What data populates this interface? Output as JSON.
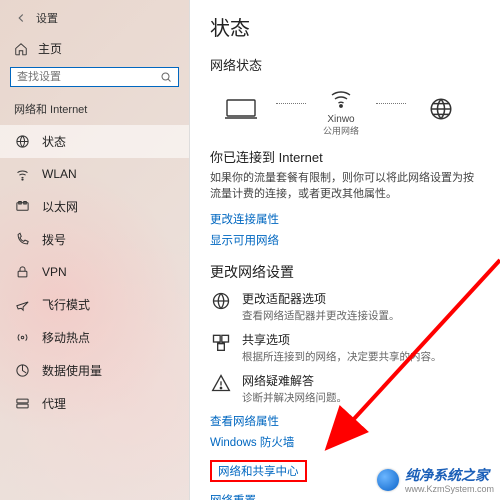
{
  "window": {
    "title": "设置"
  },
  "sidebar": {
    "home": "主页",
    "search_placeholder": "查找设置",
    "section": "网络和 Internet",
    "items": [
      {
        "label": "状态"
      },
      {
        "label": "WLAN"
      },
      {
        "label": "以太网"
      },
      {
        "label": "拨号"
      },
      {
        "label": "VPN"
      },
      {
        "label": "飞行模式"
      },
      {
        "label": "移动热点"
      },
      {
        "label": "数据使用量"
      },
      {
        "label": "代理"
      }
    ]
  },
  "content": {
    "page_title": "状态",
    "network_status_head": "网络状态",
    "diagram": {
      "pc": "",
      "router_name": "Xinwo",
      "router_sub": "公用网络",
      "globe": ""
    },
    "connected": {
      "title": "你已连接到 Internet",
      "desc": "如果你的流量套餐有限制，则你可以将此网络设置为按流量计费的连接，或者更改其他属性。",
      "link_props": "更改连接属性",
      "link_show": "显示可用网络"
    },
    "change_head": "更改网络设置",
    "settings": [
      {
        "title": "更改适配器选项",
        "desc": "查看网络适配器并更改连接设置。"
      },
      {
        "title": "共享选项",
        "desc": "根据所连接到的网络，决定要共享的内容。"
      },
      {
        "title": "网络疑难解答",
        "desc": "诊断并解决网络问题。"
      }
    ],
    "links": {
      "view_props": "查看网络属性",
      "firewall": "Windows 防火墙",
      "sharing_center": "网络和共享中心",
      "reset": "网络重置"
    }
  },
  "watermark": {
    "brand": "纯净系统之家",
    "url": "www.KzmSystem.com"
  }
}
